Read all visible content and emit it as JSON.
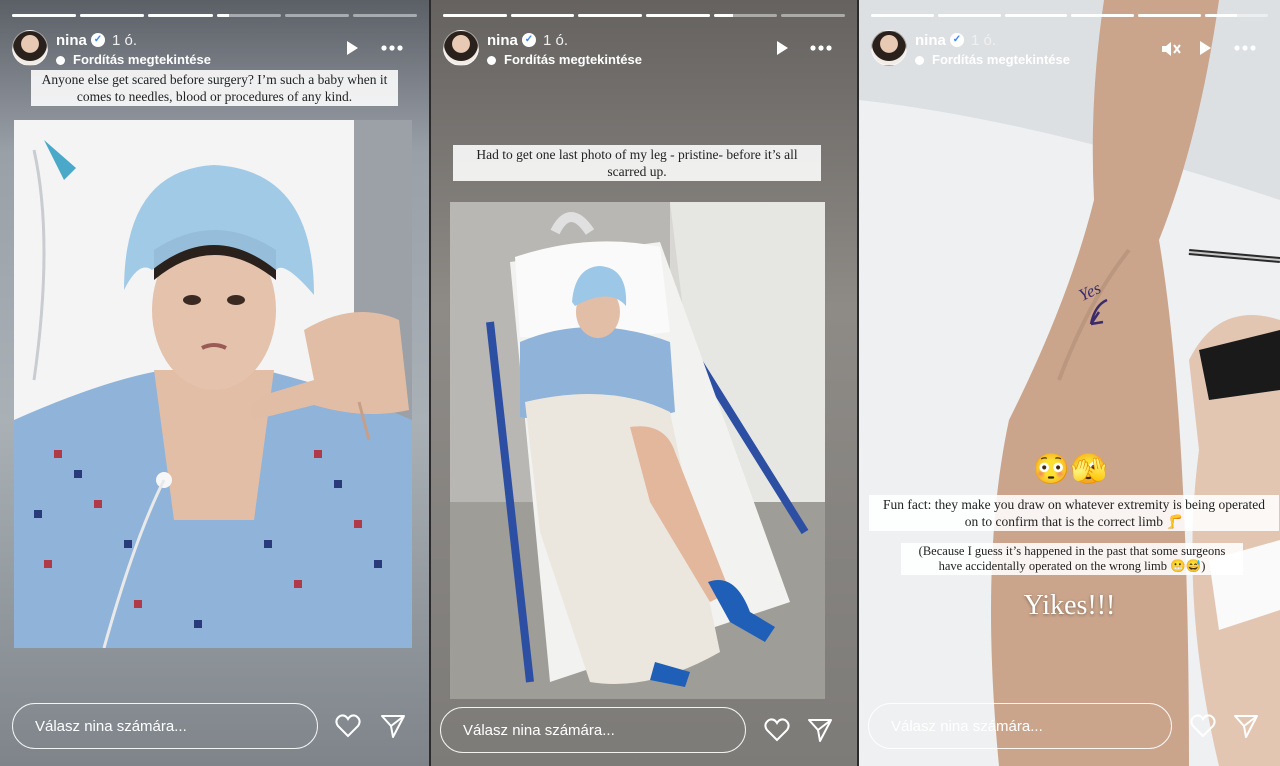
{
  "stories": [
    {
      "user": {
        "name": "nina",
        "verified_icon": "verified-badge-icon",
        "time": "1 ó."
      },
      "translate": "Fordítás megtekintése",
      "progress": [
        1,
        1,
        1,
        0.2,
        0,
        0
      ],
      "caption": "Anyone else get scared before surgery? I’m such a baby when it comes to needles, blood or procedures of any kind.",
      "reply_placeholder": "Válasz nina számára...",
      "icons": [
        "play-icon",
        "more-icon",
        "heart-icon",
        "send-icon"
      ]
    },
    {
      "user": {
        "name": "nina",
        "verified_icon": "verified-badge-icon",
        "time": "1 ó."
      },
      "translate": "Fordítás megtekintése",
      "progress": [
        1,
        1,
        1,
        1,
        0.3,
        0
      ],
      "caption": "Had to get one last photo of my leg - pristine- before it’s all scarred up.",
      "reply_placeholder": "Válasz nina számára...",
      "icons": [
        "play-icon",
        "more-icon",
        "heart-icon",
        "send-icon"
      ]
    },
    {
      "user": {
        "name": "nina",
        "verified_icon": "verified-badge-icon",
        "time": "1 ó."
      },
      "translate": "Fordítás megtekintése",
      "progress": [
        1,
        1,
        1,
        1,
        1,
        0.5
      ],
      "emoji": "😳🫣",
      "caption1": "Fun fact: they make you draw on whatever extremity is being operated on to confirm that is the correct limb 🦵",
      "caption2": "(Because I guess it’s happened in the past that some surgeons have accidentally operated on the wrong limb 😬😅)",
      "caption3": "Yikes!!!",
      "leg_text": "Yes",
      "reply_placeholder": "Válasz nina számára...",
      "icons": [
        "mute-icon",
        "play-icon",
        "more-icon",
        "heart-icon",
        "send-icon"
      ]
    }
  ],
  "colors": {
    "gown": "#8fb3d9",
    "cap": "#9cc7e6",
    "bed_rail": "#2d4fa3",
    "sock": "#1f5fb8",
    "skin": "#d9b39a"
  }
}
